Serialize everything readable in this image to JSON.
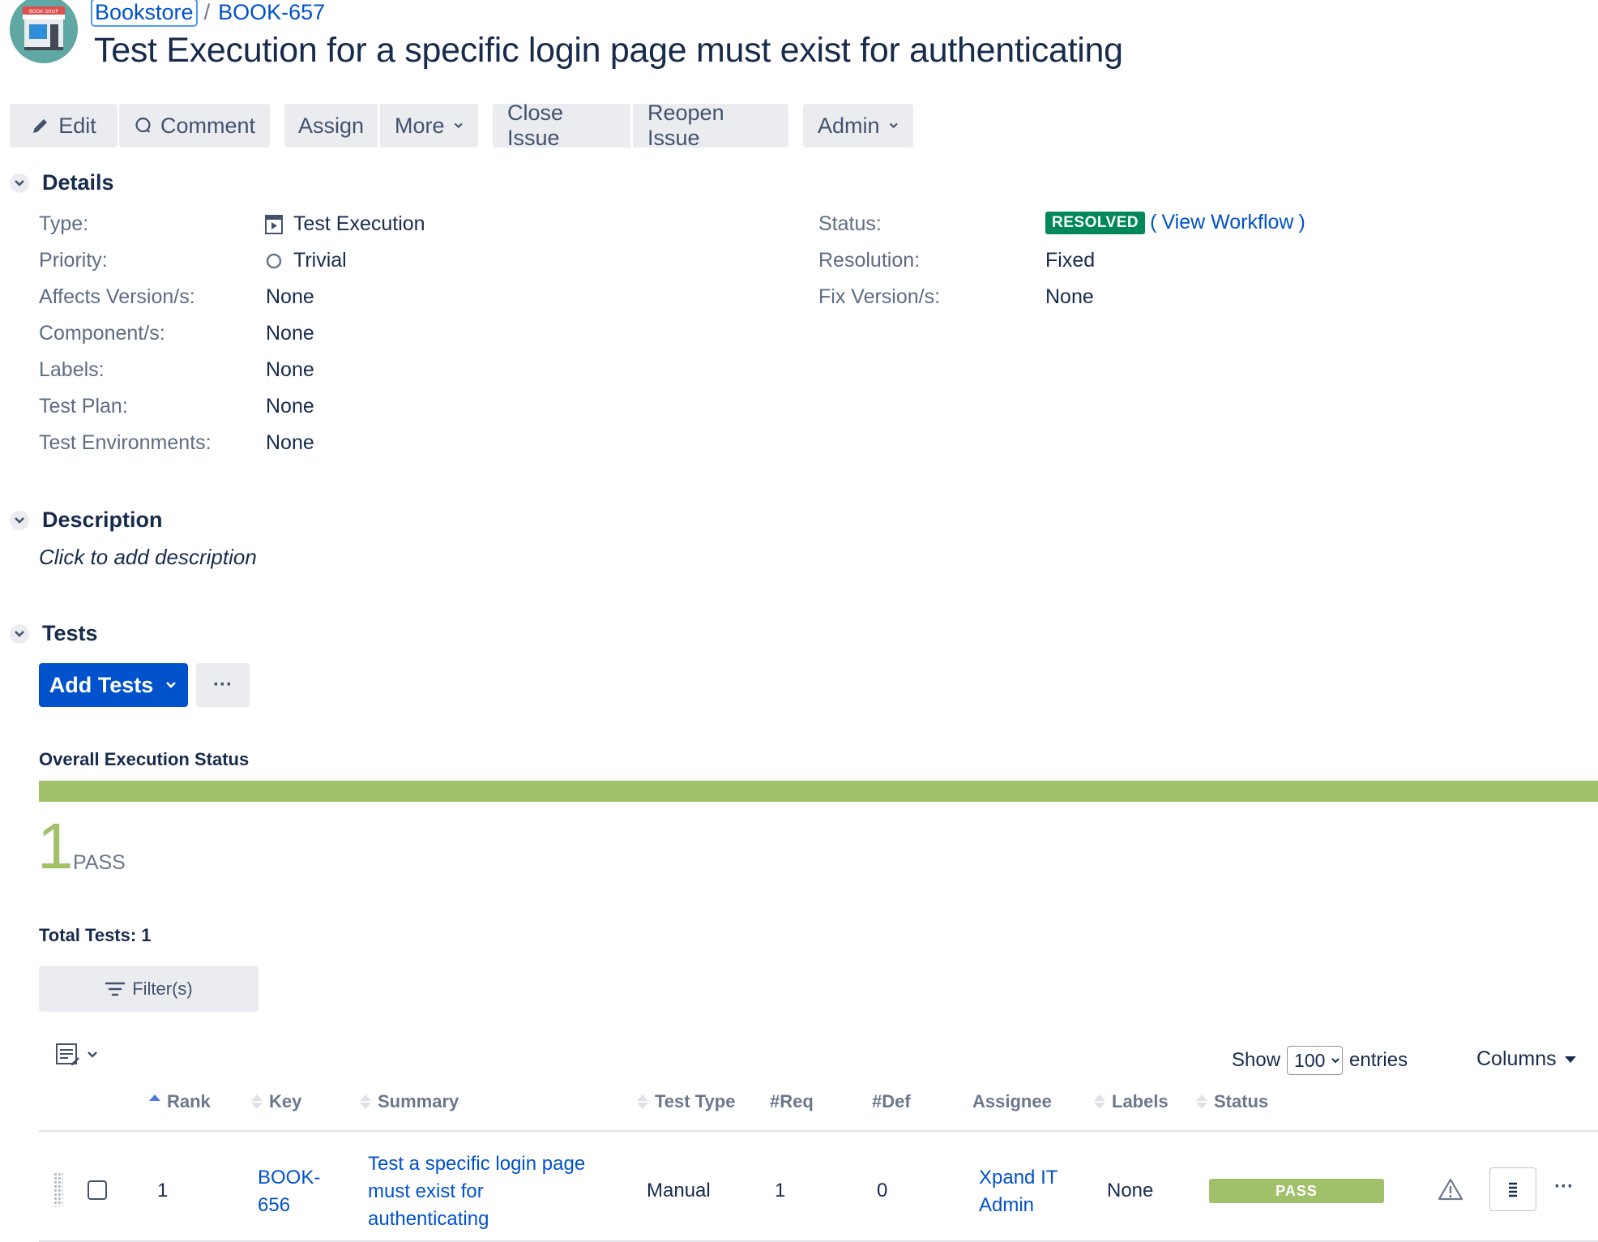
{
  "breadcrumb": {
    "project": "Bookstore",
    "separator": "/",
    "issue_key": "BOOK-657"
  },
  "avatar": {
    "text": "BOOK SHOP",
    "icon": "bookshop-storefront-icon"
  },
  "issue": {
    "title": "Test Execution for a specific login page must exist for authenticating"
  },
  "toolbar": {
    "edit": "Edit",
    "comment": "Comment",
    "assign": "Assign",
    "more": "More",
    "close_issue": "Close Issue",
    "reopen_issue": "Reopen Issue",
    "admin": "Admin"
  },
  "details": {
    "heading": "Details",
    "left": [
      {
        "label": "Type:",
        "value": "Test Execution",
        "icon": "test-execution-icon"
      },
      {
        "label": "Priority:",
        "value": "Trivial",
        "icon": "priority-trivial-icon"
      },
      {
        "label": "Affects Version/s:",
        "value": "None"
      },
      {
        "label": "Component/s:",
        "value": "None"
      },
      {
        "label": "Labels:",
        "value": "None"
      },
      {
        "label": "Test Plan:",
        "value": "None"
      },
      {
        "label": "Test Environments:",
        "value": "None"
      }
    ],
    "right": [
      {
        "label": "Status:",
        "value": "RESOLVED",
        "extra": "View Workflow"
      },
      {
        "label": "Resolution:",
        "value": "Fixed"
      },
      {
        "label": "Fix Version/s:",
        "value": "None"
      }
    ]
  },
  "description": {
    "heading": "Description",
    "placeholder": "Click to add description"
  },
  "tests": {
    "heading": "Tests",
    "add_tests": "Add Tests",
    "more": "···",
    "overall_label": "Overall Execution Status",
    "pass_fraction": 1.0,
    "pass_count": "1",
    "pass_label": "PASS",
    "total": "Total Tests: 1",
    "filter": "Filter(s)",
    "show": "Show",
    "entries_value": "100",
    "entries": "entries",
    "columns": "Columns",
    "headers": {
      "rank": "Rank",
      "key": "Key",
      "summary": "Summary",
      "test_type": "Test Type",
      "req": "#Req",
      "def": "#Def",
      "assignee": "Assignee",
      "labels": "Labels",
      "status": "Status"
    },
    "rows": [
      {
        "rank": "1",
        "key_line1": "BOOK-",
        "key_line2": "656",
        "summary_line1": "Test a specific login page",
        "summary_line2": "must exist for",
        "summary_line3": "authenticating",
        "test_type": "Manual",
        "req": "1",
        "def": "0",
        "assignee_line1": "Xpand IT",
        "assignee_line2": "Admin",
        "labels": "None",
        "status": "PASS",
        "row_more": "···"
      }
    ]
  },
  "colors": {
    "link": "#0052cc",
    "pass": "#a1c06a",
    "resolved": "#00875a",
    "primary": "#0052cc"
  }
}
